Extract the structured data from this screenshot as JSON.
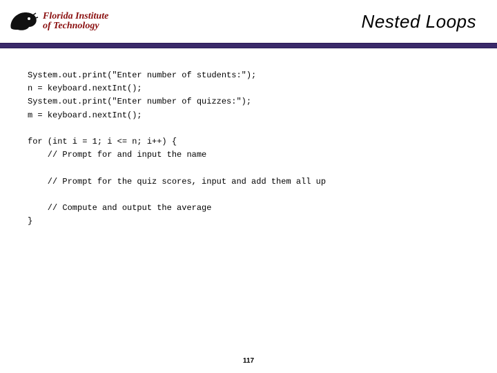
{
  "logo": {
    "line1": "Florida Institute",
    "line2": "of Technology"
  },
  "title": "Nested Loops",
  "code": "System.out.print(\"Enter number of students:\");\nn = keyboard.nextInt();\nSystem.out.print(\"Enter number of quizzes:\");\nm = keyboard.nextInt();\n\nfor (int i = 1; i <= n; i++) {\n    // Prompt for and input the name\n\n    // Prompt for the quiz scores, input and add them all up\n\n    // Compute and output the average\n}",
  "page_number": "117"
}
